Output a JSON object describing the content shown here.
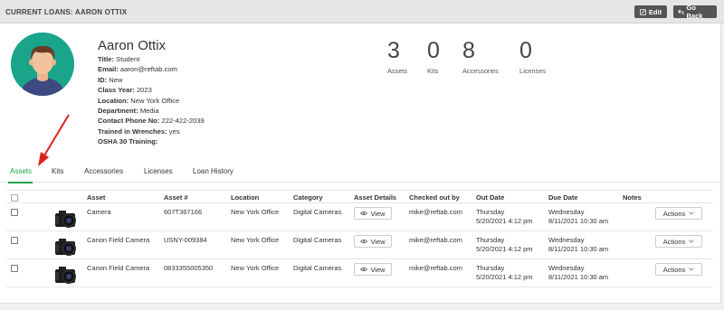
{
  "header": {
    "title": "CURRENT LOANS: AARON OTTIX",
    "edit_label": "Edit",
    "back_label": "Go Back"
  },
  "profile": {
    "name": "Aaron Ottix",
    "details": [
      {
        "label": "Title:",
        "value": "Student"
      },
      {
        "label": "Email:",
        "value": "aaron@reftab.com"
      },
      {
        "label": "ID:",
        "value": "New"
      },
      {
        "label": "Class Year:",
        "value": "2023"
      },
      {
        "label": "Location:",
        "value": "New York Office"
      },
      {
        "label": "Department:",
        "value": "Media"
      },
      {
        "label": "Contact Phone No:",
        "value": "222-422-2039"
      },
      {
        "label": "Trained in Wrenches:",
        "value": "yes"
      },
      {
        "label": "OSHA 30 Training:",
        "value": ""
      }
    ]
  },
  "stats": [
    {
      "value": "3",
      "label": "Assets"
    },
    {
      "value": "0",
      "label": "Kits"
    },
    {
      "value": "8",
      "label": "Accessories"
    },
    {
      "value": "0",
      "label": "Licenses"
    }
  ],
  "tabs": [
    "Assets",
    "Kits",
    "Accessories",
    "Licenses",
    "Loan History"
  ],
  "table": {
    "columns": [
      "Asset",
      "Asset #",
      "Location",
      "Category",
      "Asset Details",
      "Checked out by",
      "Out Date",
      "Due Date",
      "Notes"
    ],
    "view_label": "View",
    "actions_label": "Actions",
    "rows": [
      {
        "asset": "Camera",
        "asset_no": "607T367166",
        "location": "New York Office",
        "category": "Digital Cameras",
        "checked_out_by": "mike@reftab.com",
        "out_day": "Thursday",
        "out_date": "5/20/2021 4:12 pm",
        "due_day": "Wednesday",
        "due_date": "8/11/2021 10:30 am",
        "notes": ""
      },
      {
        "asset": "Canon Field Camera",
        "asset_no": "USNY-009384",
        "location": "New York Office",
        "category": "Digital Cameras",
        "checked_out_by": "mike@reftab.com",
        "out_day": "Thursday",
        "out_date": "5/20/2021 4:12 pm",
        "due_day": "Wednesday",
        "due_date": "8/11/2021 10:30 am",
        "notes": ""
      },
      {
        "asset": "Canon Field Camera",
        "asset_no": "0833355005350",
        "location": "New York Office",
        "category": "Digital Cameras",
        "checked_out_by": "mike@reftab.com",
        "out_day": "Thursday",
        "out_date": "5/20/2021 4:12 pm",
        "due_day": "Wednesday",
        "due_date": "8/11/2021 10:30 am",
        "notes": ""
      }
    ]
  },
  "colors": {
    "accent": "#1aa24a",
    "avatar_bg": "#1aa48a",
    "annotation_arrow": "#e02020"
  },
  "icons": {
    "edit": "edit-icon",
    "back": "back-arrow-icon",
    "view": "eye-icon",
    "actions": "chevron-down-icon"
  }
}
